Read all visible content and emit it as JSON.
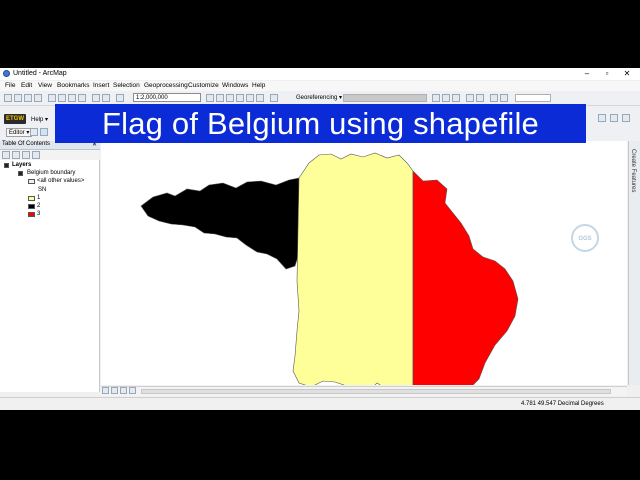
{
  "window": {
    "title": "Untitled - ArcMap",
    "controls": [
      "–",
      "▫",
      "✕"
    ]
  },
  "menu": [
    "File",
    "Edit",
    "View",
    "Bookmarks",
    "Insert",
    "Selection",
    "Geoprocessing",
    "Customize",
    "Windows",
    "Help"
  ],
  "toolbar": {
    "scale": "1:2,000,000",
    "georeferencing": "Georeferencing ▾",
    "help": "Help ▾",
    "editor": "Editor ▾",
    "etgw": "ETGW"
  },
  "toc": {
    "title": "Table Of Contents",
    "pin": "✕",
    "layers_label": "Layers",
    "layer_name": "Belgium boundary",
    "other_values": "<all other values>",
    "field": "SN",
    "classes": [
      {
        "label": "1",
        "color": "#ffff99"
      },
      {
        "label": "2",
        "color": "#000000"
      },
      {
        "label": "3",
        "color": "#ff0000"
      }
    ]
  },
  "dock": {
    "create_features": "Create Features"
  },
  "watermark": "GGS",
  "banner": {
    "text": "Flag of Belgium using shapefile",
    "color": "#0a2bd6"
  },
  "status": {
    "coords": "4.781  49.547 Decimal Degrees"
  },
  "colors": {
    "black": "#000000",
    "yellow": "#ffff99",
    "red": "#ff0000"
  }
}
